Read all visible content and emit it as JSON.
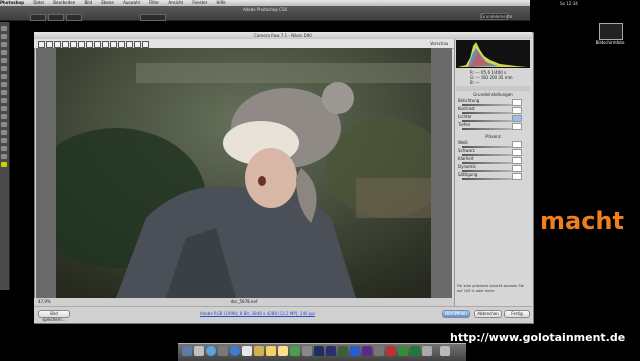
{
  "menubar": {
    "items": [
      "Photoshop",
      "Datei",
      "Bearbeiten",
      "Bild",
      "Ebene",
      "Auswahl",
      "Filter",
      "Ansicht",
      "Fenster",
      "Hilfe"
    ]
  },
  "ps": {
    "title": "Adobe Photoshop CS6",
    "essentials": "Grundelemente"
  },
  "clock": "So 12:34",
  "desktop_icon_label": "Bildschirmfoto",
  "acr": {
    "title": "Camera Raw 7.1 - Nikon D90",
    "preview_label": "Vorschau",
    "zoom": "47,9%",
    "filename": "dsc_5678.nef",
    "workflow_link": "Adobe RGB (1998); 8 Bit; 2848 x 4288 (12,2 MP); 240 ppi",
    "buttons": {
      "save": "Bild speichern...",
      "open": "Bild öffnen",
      "cancel": "Abbrechen",
      "done": "Fertig"
    },
    "rgb": [
      "R: ---  f/5.6  1/400 s",
      "G: ---  ISO 200  35 mm",
      "B: ---"
    ],
    "panel_title": "Grundeinstellungen",
    "panel_title2": "Präsenz",
    "sliders": [
      "Belichtung",
      "Kontrast",
      "Lichter",
      "Tiefen",
      "Weiß",
      "Schwarz",
      "Klarheit",
      "Dynamik",
      "Sättigung"
    ],
    "footer_note": "Für eine präzisere Ansicht zoomen Sie auf 100 % oder mehr."
  },
  "overlay": {
    "word": "macht",
    "url": "http://www.golotainment.de"
  },
  "colors": {
    "accent_orange": "#ef7f1a"
  }
}
